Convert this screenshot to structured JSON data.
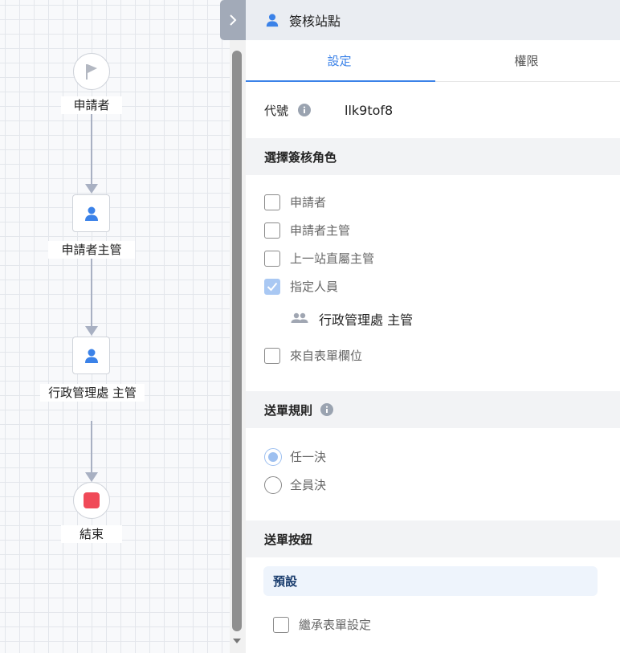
{
  "flow": {
    "nodes": [
      {
        "type": "start",
        "label": "申請者"
      },
      {
        "type": "task",
        "label": "申請者主管"
      },
      {
        "type": "task",
        "label": "行政管理處 主管"
      },
      {
        "type": "end",
        "label": "結束"
      }
    ]
  },
  "panel": {
    "title": "簽核站點",
    "tabs": [
      {
        "label": "設定",
        "active": true
      },
      {
        "label": "權限",
        "active": false
      }
    ],
    "code_label": "代號",
    "code_value": "llk9tof8",
    "roles_section": "選擇簽核角色",
    "roles": [
      {
        "label": "申請者",
        "checked": false
      },
      {
        "label": "申請者主管",
        "checked": false
      },
      {
        "label": "上一站直屬主管",
        "checked": false
      },
      {
        "label": "指定人員",
        "checked": true
      }
    ],
    "assignee": "行政管理處 主管",
    "form_field_option": {
      "label": "來自表單欄位",
      "checked": false
    },
    "send_rule_section": "送單規則",
    "send_rules": [
      {
        "label": "任一決",
        "selected": true
      },
      {
        "label": "全員決",
        "selected": false
      }
    ],
    "send_button_section": "送單按鈕",
    "preset_label": "預設",
    "inherit_option": {
      "label": "繼承表單設定",
      "checked": false
    }
  },
  "colors": {
    "accent": "#3b82e8",
    "end_node": "#f04a58",
    "checked_fill": "#a9c8f3",
    "edge": "#a8b0c2"
  }
}
